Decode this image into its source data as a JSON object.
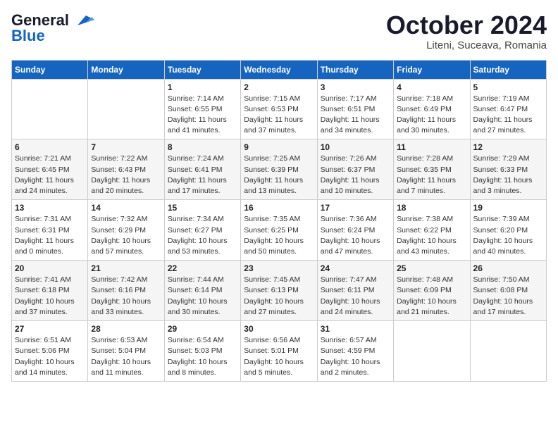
{
  "logo": {
    "line1": "General",
    "line2": "Blue"
  },
  "title": "October 2024",
  "subtitle": "Liteni, Suceava, Romania",
  "headers": [
    "Sunday",
    "Monday",
    "Tuesday",
    "Wednesday",
    "Thursday",
    "Friday",
    "Saturday"
  ],
  "weeks": [
    [
      {
        "day": "",
        "info": ""
      },
      {
        "day": "",
        "info": ""
      },
      {
        "day": "1",
        "info": "Sunrise: 7:14 AM\nSunset: 6:55 PM\nDaylight: 11 hours and 41 minutes."
      },
      {
        "day": "2",
        "info": "Sunrise: 7:15 AM\nSunset: 6:53 PM\nDaylight: 11 hours and 37 minutes."
      },
      {
        "day": "3",
        "info": "Sunrise: 7:17 AM\nSunset: 6:51 PM\nDaylight: 11 hours and 34 minutes."
      },
      {
        "day": "4",
        "info": "Sunrise: 7:18 AM\nSunset: 6:49 PM\nDaylight: 11 hours and 30 minutes."
      },
      {
        "day": "5",
        "info": "Sunrise: 7:19 AM\nSunset: 6:47 PM\nDaylight: 11 hours and 27 minutes."
      }
    ],
    [
      {
        "day": "6",
        "info": "Sunrise: 7:21 AM\nSunset: 6:45 PM\nDaylight: 11 hours and 24 minutes."
      },
      {
        "day": "7",
        "info": "Sunrise: 7:22 AM\nSunset: 6:43 PM\nDaylight: 11 hours and 20 minutes."
      },
      {
        "day": "8",
        "info": "Sunrise: 7:24 AM\nSunset: 6:41 PM\nDaylight: 11 hours and 17 minutes."
      },
      {
        "day": "9",
        "info": "Sunrise: 7:25 AM\nSunset: 6:39 PM\nDaylight: 11 hours and 13 minutes."
      },
      {
        "day": "10",
        "info": "Sunrise: 7:26 AM\nSunset: 6:37 PM\nDaylight: 11 hours and 10 minutes."
      },
      {
        "day": "11",
        "info": "Sunrise: 7:28 AM\nSunset: 6:35 PM\nDaylight: 11 hours and 7 minutes."
      },
      {
        "day": "12",
        "info": "Sunrise: 7:29 AM\nSunset: 6:33 PM\nDaylight: 11 hours and 3 minutes."
      }
    ],
    [
      {
        "day": "13",
        "info": "Sunrise: 7:31 AM\nSunset: 6:31 PM\nDaylight: 11 hours and 0 minutes."
      },
      {
        "day": "14",
        "info": "Sunrise: 7:32 AM\nSunset: 6:29 PM\nDaylight: 10 hours and 57 minutes."
      },
      {
        "day": "15",
        "info": "Sunrise: 7:34 AM\nSunset: 6:27 PM\nDaylight: 10 hours and 53 minutes."
      },
      {
        "day": "16",
        "info": "Sunrise: 7:35 AM\nSunset: 6:25 PM\nDaylight: 10 hours and 50 minutes."
      },
      {
        "day": "17",
        "info": "Sunrise: 7:36 AM\nSunset: 6:24 PM\nDaylight: 10 hours and 47 minutes."
      },
      {
        "day": "18",
        "info": "Sunrise: 7:38 AM\nSunset: 6:22 PM\nDaylight: 10 hours and 43 minutes."
      },
      {
        "day": "19",
        "info": "Sunrise: 7:39 AM\nSunset: 6:20 PM\nDaylight: 10 hours and 40 minutes."
      }
    ],
    [
      {
        "day": "20",
        "info": "Sunrise: 7:41 AM\nSunset: 6:18 PM\nDaylight: 10 hours and 37 minutes."
      },
      {
        "day": "21",
        "info": "Sunrise: 7:42 AM\nSunset: 6:16 PM\nDaylight: 10 hours and 33 minutes."
      },
      {
        "day": "22",
        "info": "Sunrise: 7:44 AM\nSunset: 6:14 PM\nDaylight: 10 hours and 30 minutes."
      },
      {
        "day": "23",
        "info": "Sunrise: 7:45 AM\nSunset: 6:13 PM\nDaylight: 10 hours and 27 minutes."
      },
      {
        "day": "24",
        "info": "Sunrise: 7:47 AM\nSunset: 6:11 PM\nDaylight: 10 hours and 24 minutes."
      },
      {
        "day": "25",
        "info": "Sunrise: 7:48 AM\nSunset: 6:09 PM\nDaylight: 10 hours and 21 minutes."
      },
      {
        "day": "26",
        "info": "Sunrise: 7:50 AM\nSunset: 6:08 PM\nDaylight: 10 hours and 17 minutes."
      }
    ],
    [
      {
        "day": "27",
        "info": "Sunrise: 6:51 AM\nSunset: 5:06 PM\nDaylight: 10 hours and 14 minutes."
      },
      {
        "day": "28",
        "info": "Sunrise: 6:53 AM\nSunset: 5:04 PM\nDaylight: 10 hours and 11 minutes."
      },
      {
        "day": "29",
        "info": "Sunrise: 6:54 AM\nSunset: 5:03 PM\nDaylight: 10 hours and 8 minutes."
      },
      {
        "day": "30",
        "info": "Sunrise: 6:56 AM\nSunset: 5:01 PM\nDaylight: 10 hours and 5 minutes."
      },
      {
        "day": "31",
        "info": "Sunrise: 6:57 AM\nSunset: 4:59 PM\nDaylight: 10 hours and 2 minutes."
      },
      {
        "day": "",
        "info": ""
      },
      {
        "day": "",
        "info": ""
      }
    ]
  ]
}
